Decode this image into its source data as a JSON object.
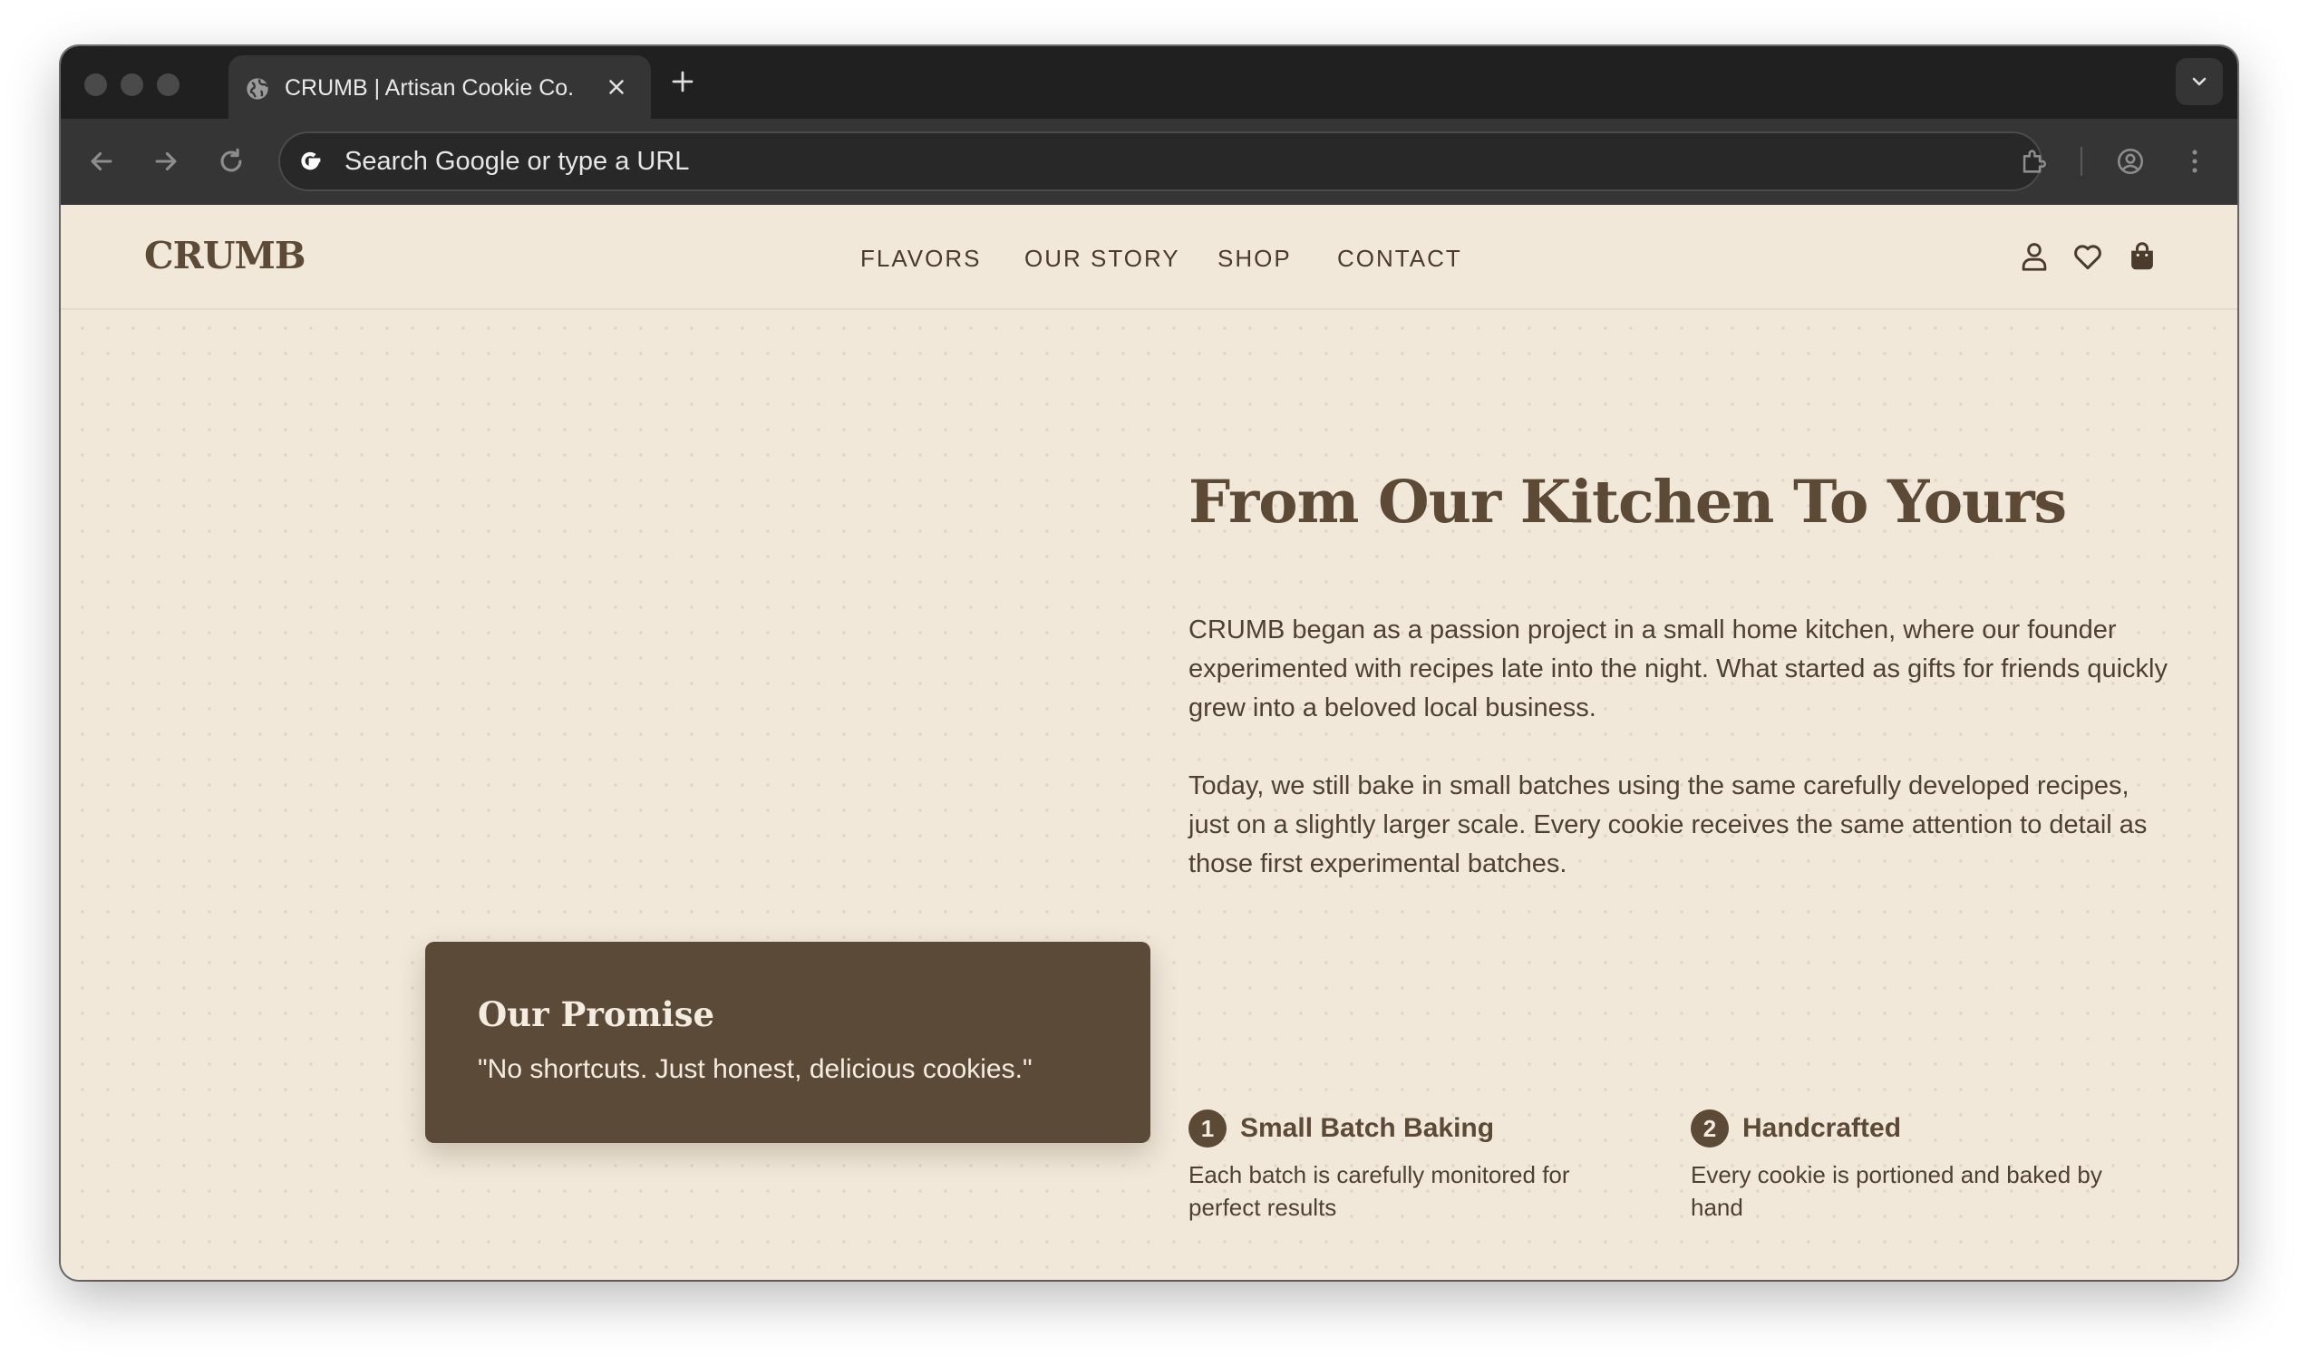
{
  "browser": {
    "tab_title": "CRUMB | Artisan Cookie Co.",
    "omnibox_placeholder": "Search Google or type a URL"
  },
  "site": {
    "logo": "CRUMB",
    "nav": [
      "FLAVORS",
      "OUR STORY",
      "SHOP",
      "CONTACT"
    ]
  },
  "hero": {
    "title": "From Our Kitchen To Yours",
    "paragraphs": [
      "CRUMB began as a passion project in a small home kitchen, where our founder experimented with recipes late into the night. What started as gifts for friends quickly grew into a beloved local business.",
      "Today, we still bake in small batches using the same carefully developed recipes, just on a slightly larger scale. Every cookie receives the same attention to detail as those first experimental batches."
    ],
    "features": [
      {
        "number": "1",
        "title": "Small Batch Baking",
        "description": "Each batch is carefully monitored for perfect results"
      },
      {
        "number": "2",
        "title": "Handcrafted",
        "description": "Every cookie is portioned and baked by hand"
      }
    ]
  },
  "promise": {
    "title": "Our Promise",
    "quote": "\"No shortcuts. Just honest, delicious cookies.\""
  },
  "colors": {
    "page_background": "#f1e8da",
    "brand_brown": "#5c4a37",
    "promise_card": "#5c4a38",
    "browser_chrome": "#202020"
  },
  "icons": {
    "browser": [
      "globe-icon",
      "close-icon",
      "plus-icon",
      "chevron-down-icon",
      "back-arrow-icon",
      "forward-arrow-icon",
      "reload-icon",
      "google-g-icon",
      "extensions-puzzle-icon",
      "profile-icon",
      "kebab-menu-icon"
    ],
    "site_header": [
      "account-icon",
      "heart-icon",
      "shopping-bag-icon"
    ]
  }
}
